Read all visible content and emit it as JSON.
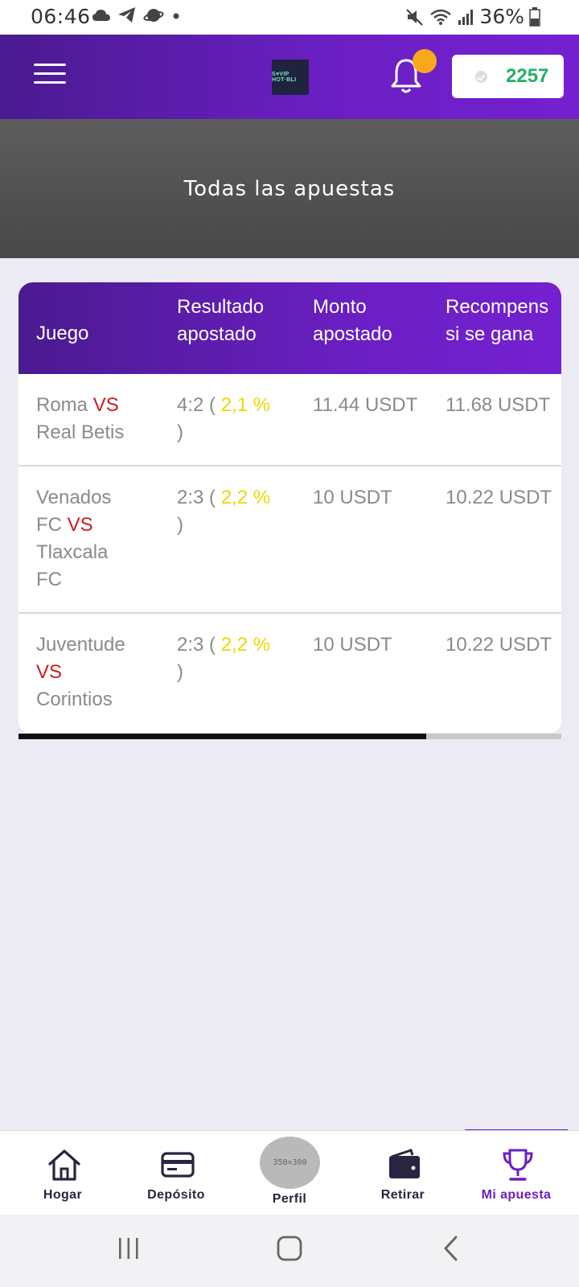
{
  "status_bar": {
    "time": "06:46",
    "battery": "36%"
  },
  "header": {
    "logo_text": "S♥VIP HOT·BLI",
    "balance": "2257"
  },
  "banner": {
    "title": "Todas las apuestas"
  },
  "table": {
    "headers": {
      "game": "Juego",
      "result_line1": "Resultado",
      "result_line2": "apostado",
      "amount_line1": "Monto",
      "amount_line2": "apostado",
      "reward_line1": "Recompens",
      "reward_line2": "si se gana"
    },
    "rows": [
      {
        "game_lines": [
          {
            "pre": "Roma ",
            "vs": "VS",
            "post": ""
          },
          {
            "pre": "Real Betis",
            "vs": "",
            "post": ""
          }
        ],
        "score": "4:2 ( ",
        "pct": "2,1 %",
        "close": ")",
        "amount": "11.44 USDT",
        "reward": "11.68 USDT"
      },
      {
        "game_lines": [
          {
            "pre": "Venados",
            "vs": "",
            "post": ""
          },
          {
            "pre": "FC ",
            "vs": "VS",
            "post": ""
          },
          {
            "pre": "Tlaxcala",
            "vs": "",
            "post": ""
          },
          {
            "pre": "FC",
            "vs": "",
            "post": ""
          }
        ],
        "score": "2:3 ( ",
        "pct": "2,2 %",
        "close": ")",
        "amount": "10 USDT",
        "reward": "10.22 USDT"
      },
      {
        "game_lines": [
          {
            "pre": "Juventude",
            "vs": "",
            "post": ""
          },
          {
            "pre": "",
            "vs": "VS",
            "post": ""
          },
          {
            "pre": "Corintios",
            "vs": "",
            "post": ""
          }
        ],
        "score": "2:3 ( ",
        "pct": "2,2 %",
        "close": ")",
        "amount": "10 USDT",
        "reward": "10.22 USDT"
      }
    ]
  },
  "bottom_nav": {
    "home": "Hogar",
    "deposit": "Depósito",
    "avatar_placeholder": "350×300",
    "profile": "Perfil",
    "withdraw": "Retirar",
    "my_bet": "Mi apuesta"
  },
  "colors": {
    "header_purple": "#6a1fc2",
    "balance_green": "#22b06a",
    "vs_red": "#cc1d1d",
    "pct_yellow": "#f0d600",
    "notification_orange": "#f7a81c"
  }
}
